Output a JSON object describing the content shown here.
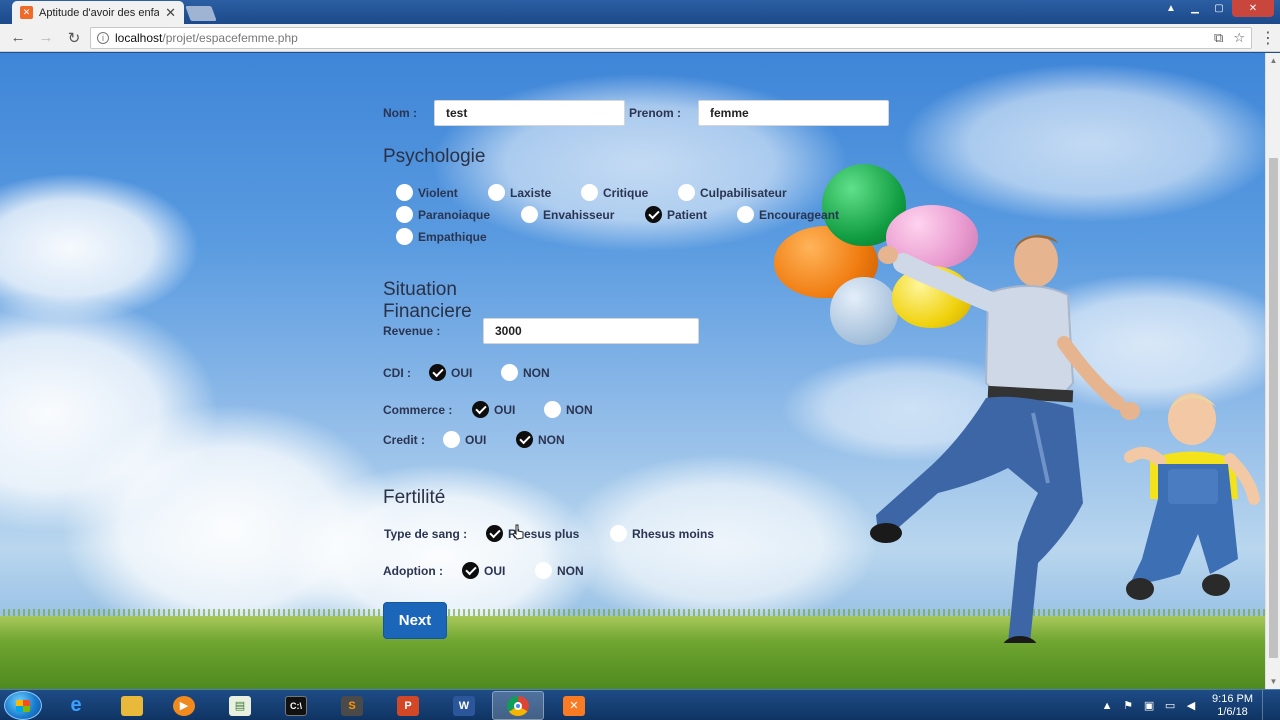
{
  "browser": {
    "tab_title": "Aptitude d'avoir des enfants",
    "url_host": "localhost",
    "url_path": "/projet/espacefemme.php"
  },
  "form": {
    "nom_label": "Nom :",
    "nom_value": "test",
    "prenom_label": "Prenom :",
    "prenom_value": "femme",
    "psychologie": {
      "title": "Psychologie",
      "options": [
        {
          "label": "Violent",
          "checked": false
        },
        {
          "label": "Laxiste",
          "checked": false
        },
        {
          "label": "Critique",
          "checked": false
        },
        {
          "label": "Culpabilisateur",
          "checked": false
        },
        {
          "label": "Paranoiaque",
          "checked": false
        },
        {
          "label": "Envahisseur",
          "checked": false
        },
        {
          "label": "Patient",
          "checked": true
        },
        {
          "label": "Encourageant",
          "checked": false
        },
        {
          "label": "Empathique",
          "checked": false
        }
      ]
    },
    "financiere": {
      "title": "Situation Financiere",
      "revenue_label": "Revenue :",
      "revenue_value": "3000",
      "cdi": {
        "label": "CDI :",
        "oui": "OUI",
        "non": "NON",
        "selected": "OUI"
      },
      "commerce": {
        "label": "Commerce :",
        "oui": "OUI",
        "non": "NON",
        "selected": "OUI"
      },
      "credit": {
        "label": "Credit :",
        "oui": "OUI",
        "non": "NON",
        "selected": "NON"
      }
    },
    "fertilite": {
      "title": "Fertilité",
      "sang": {
        "label": "Type de sang :",
        "plus": "Rhesus plus",
        "moins": "Rhesus moins",
        "selected": "Rhesus plus"
      },
      "adoption": {
        "label": "Adoption :",
        "oui": "OUI",
        "non": "NON",
        "selected": "OUI"
      }
    },
    "next_label": "Next"
  },
  "taskbar": {
    "apps": [
      "internet-explorer",
      "file-explorer",
      "media-player",
      "notepad",
      "command-prompt",
      "sublime-text",
      "powerpoint",
      "word",
      "chrome",
      "xampp"
    ],
    "active_app": "chrome",
    "clock_time": "9:16 PM",
    "clock_date": "1/6/18"
  },
  "colors": {
    "accent": "#1b66b8",
    "label_text": "#2b3450"
  }
}
